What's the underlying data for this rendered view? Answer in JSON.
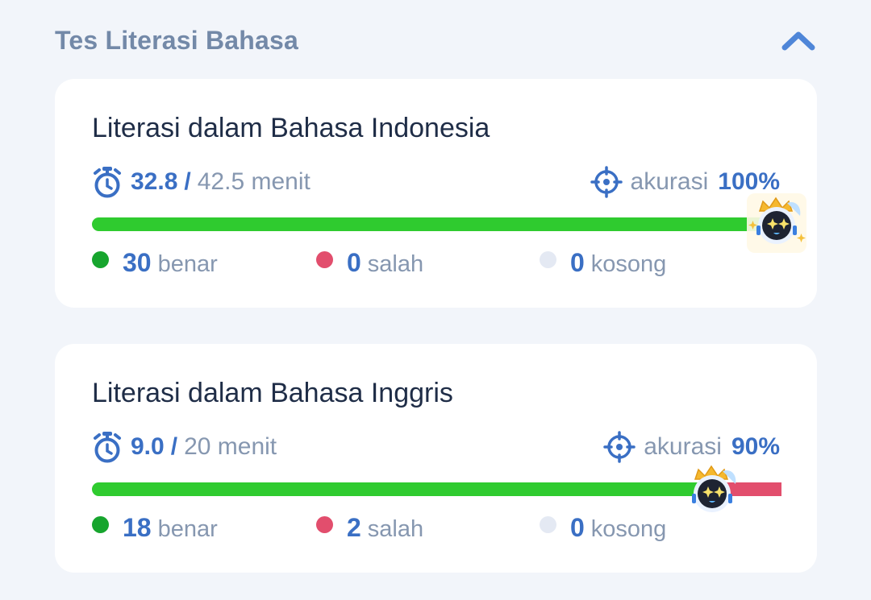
{
  "section": {
    "title": "Tes Literasi Bahasa",
    "collapse_icon": "chevron-up-icon"
  },
  "cards": [
    {
      "title": "Literasi dalam Bahasa Indonesia",
      "time_used": "32.8",
      "slash": "/",
      "time_total": "42.5 menit",
      "accuracy_label": "akurasi",
      "accuracy_value": "100%",
      "progress": {
        "correct_fraction": 1.0,
        "wrong_fraction": 0.0
      },
      "stats": {
        "correct": {
          "value": "30",
          "label": "benar"
        },
        "wrong": {
          "value": "0",
          "label": "salah"
        },
        "empty": {
          "value": "0",
          "label": "kosong"
        }
      }
    },
    {
      "title": "Literasi dalam Bahasa Inggris",
      "time_used": "9.0",
      "slash": "/",
      "time_total": "20 menit",
      "accuracy_label": "akurasi",
      "accuracy_value": "90%",
      "progress": {
        "correct_fraction": 0.9,
        "wrong_fraction": 0.1
      },
      "stats": {
        "correct": {
          "value": "18",
          "label": "benar"
        },
        "wrong": {
          "value": "2",
          "label": "salah"
        },
        "empty": {
          "value": "0",
          "label": "kosong"
        }
      }
    }
  ],
  "colors": {
    "correct": "#2fcb2f",
    "correct_dot": "#17a52e",
    "wrong": "#e24e6d",
    "empty": "#e4e9f3",
    "accent": "#3a6fc4"
  },
  "icons": [
    "stopwatch-icon",
    "crosshair-icon",
    "mascot-icon",
    "chevron-up-icon"
  ]
}
